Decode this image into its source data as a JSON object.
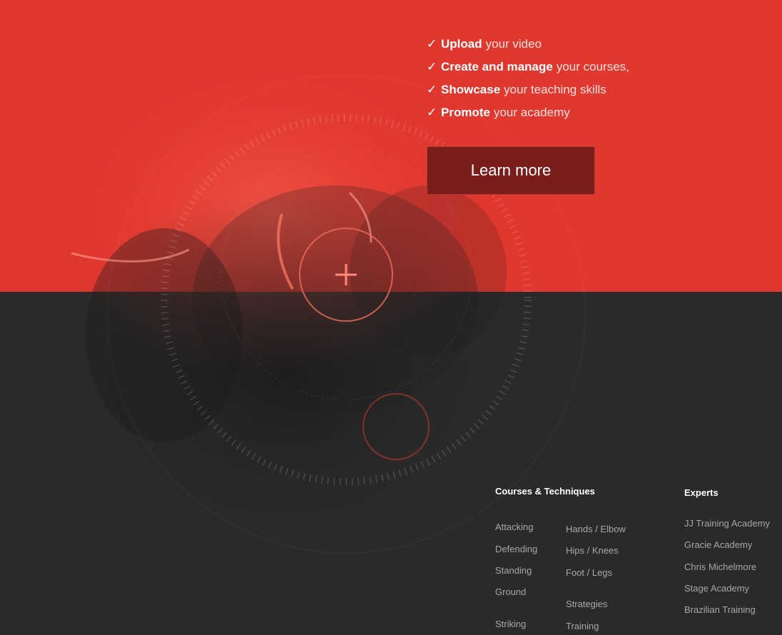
{
  "features": [
    {
      "strong": "Upload",
      "rest": "your video"
    },
    {
      "strong": "Create and manage",
      "rest": "your courses,"
    },
    {
      "strong": "Showcase",
      "rest": "your teaching skills"
    },
    {
      "strong": "Promote",
      "rest": "your academy"
    }
  ],
  "check_glyph": "✓",
  "cta": {
    "label": "Learn more"
  },
  "footer": {
    "courses_heading": "Courses & Techniques",
    "experts_heading": "Experts",
    "courses_col1": [
      "Attacking",
      "Defending",
      "Standing",
      "Ground",
      "Striking"
    ],
    "courses_col2": [
      "Hands / Elbow",
      "Hips / Knees",
      "Foot / Legs",
      "Strategies",
      "Training"
    ],
    "experts": [
      "JJ Training Academy",
      "Gracie Academy",
      "Chris Michelmore",
      "Stage Academy",
      "Brazilian Training"
    ]
  },
  "colors": {
    "brand_red": "#e0372f",
    "dark_bg": "#2b2a2a",
    "button_bg": "#7a1e1c"
  },
  "icons": {
    "plus": "plus-icon"
  }
}
